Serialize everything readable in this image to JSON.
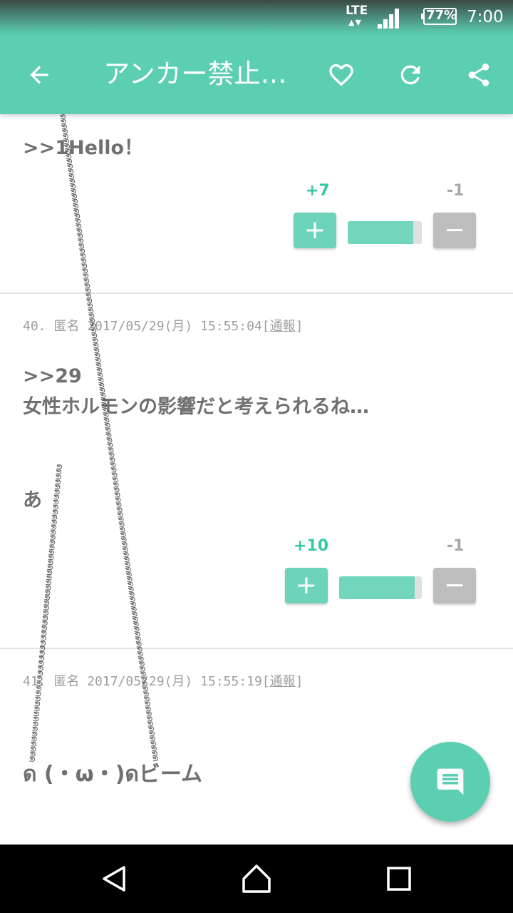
{
  "status_bar": {
    "network": "LTE",
    "network_arrows": "▲▼",
    "battery": "77%",
    "time": "7:00"
  },
  "app_bar": {
    "title": "アンカー禁止…",
    "icons": [
      "back-arrow-icon",
      "heart-icon",
      "refresh-icon",
      "share-icon"
    ]
  },
  "posts": [
    {
      "text": ">>1Hello！",
      "votes": {
        "plus": "+7",
        "minus": "-1",
        "ratio": 0.88
      }
    },
    {
      "number": "40.",
      "name": "匿名",
      "date": "2017/05/29(月) 15:55:04",
      "report_open": "[",
      "report": "通報",
      "report_close": "]",
      "anchor": ">>29",
      "line1": "女性ホルモンの影響だと考えられるね…",
      "line2": "あ",
      "votes": {
        "plus": "+10",
        "minus": "-1",
        "ratio": 0.91
      }
    },
    {
      "number": "41.",
      "name": "匿名",
      "date": "2017/05/29(月) 15:55:19",
      "report_open": "[",
      "report": "通報",
      "report_close": "]",
      "text": "ด (・ω・)ดビーム"
    }
  ],
  "ascii_art": {
    "char": "ด"
  },
  "colors": {
    "accent": "#5ccfb2",
    "plus": "#35c9a3",
    "minus": "#bdbdbd"
  },
  "fab": {
    "icon": "comment-icon"
  },
  "nav_bar": {
    "icons": [
      "nav-back-icon",
      "nav-home-icon",
      "nav-recents-icon"
    ]
  }
}
